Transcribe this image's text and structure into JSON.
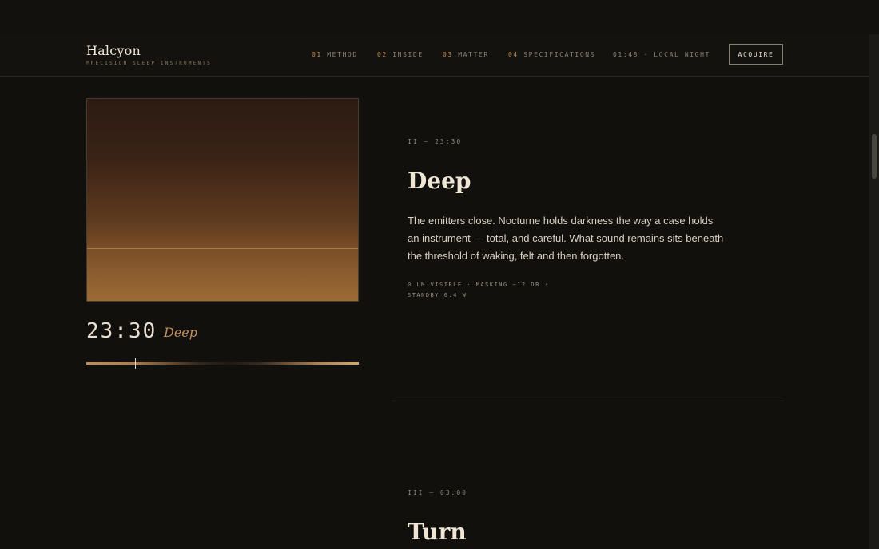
{
  "brand": {
    "title": "Halcyon",
    "subtitle": "PRECISION SLEEP INSTRUMENTS"
  },
  "nav": {
    "items": [
      {
        "num": "01",
        "label": "METHOD"
      },
      {
        "num": "02",
        "label": "INSIDE"
      },
      {
        "num": "03",
        "label": "MATTER"
      },
      {
        "num": "04",
        "label": "SPECIFICATIONS"
      }
    ],
    "clock": "01:48 · LOCAL NIGHT",
    "cta": "ACQUIRE"
  },
  "visual": {
    "time": "23:30",
    "phase": "Deep",
    "progress": 0.18
  },
  "sections": [
    {
      "kicker": "II — 23:30",
      "title": "Deep",
      "body": "The emitters close. Nocturne holds darkness the way a case holds an instrument — total, and careful. What sound remains sits beneath the threshold of waking, felt and then forgotten.",
      "spec_line1": "0 LM VISIBLE · MASKING −12 DB ·",
      "spec_line2": "STANDBY 0.4 W"
    },
    {
      "kicker": "III — 03:00",
      "title": "Turn"
    }
  ],
  "colors": {
    "background": "#12100c",
    "accent": "#c08a45",
    "phase": "#c9925a"
  }
}
